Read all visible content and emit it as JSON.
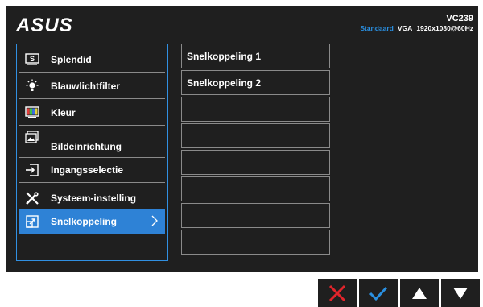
{
  "header": {
    "brand": "ASUS",
    "model": "VC239",
    "mode": "Standaard",
    "input": "VGA",
    "resolution": "1920x1080@60Hz"
  },
  "menu": {
    "items": [
      {
        "label": "Splendid",
        "icon": "splendid-icon"
      },
      {
        "label": "Blauwlichtfilter",
        "icon": "bulb-icon"
      },
      {
        "label": "Kleur",
        "icon": "color-icon"
      },
      {
        "label": "Bildeinrichtung",
        "icon": "image-icon"
      },
      {
        "label": "Ingangsselectie",
        "icon": "input-icon"
      },
      {
        "label": "Systeem-instelling",
        "icon": "tools-icon"
      },
      {
        "label": "Snelkoppeling",
        "icon": "shortcut-icon",
        "selected": true
      }
    ]
  },
  "submenu": {
    "items": [
      "Snelkoppeling 1",
      "Snelkoppeling 2",
      "",
      "",
      "",
      "",
      "",
      ""
    ]
  },
  "buttons": {
    "close": "close-icon",
    "ok": "check-icon",
    "up": "up-arrow-icon",
    "down": "down-arrow-icon"
  },
  "colors": {
    "accent": "#2e82d6",
    "close": "#e3242b",
    "ok": "#2a8fe0",
    "panel": "#1f1f1f"
  }
}
